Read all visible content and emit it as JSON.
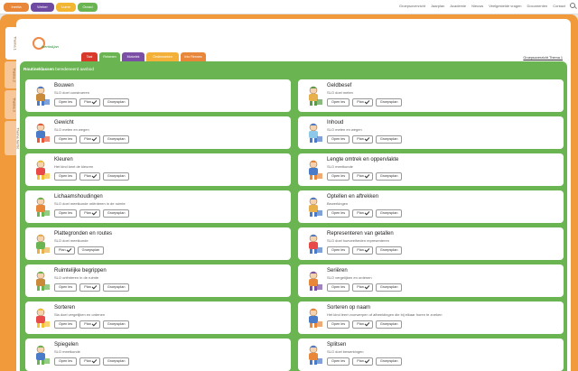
{
  "topbar": {
    "tabs": [
      {
        "label": "Inertia",
        "color": "#e8873a"
      },
      {
        "label": "Weber",
        "color": "#6e4aa0"
      },
      {
        "label": "Lume",
        "color": "#f2b632"
      },
      {
        "label": "Oorad",
        "color": "#6ab552"
      }
    ],
    "links": [
      "Groepsoverzicht",
      "Jaarplan",
      "Academie",
      "Nieuws",
      "Veelgestelde vragen",
      "Documenten",
      "Contact"
    ]
  },
  "sidetabs": [
    "Thema 1",
    "Thema 2",
    "Thema 3",
    "Thema herfst"
  ],
  "logo": {
    "text": "inertia&jan"
  },
  "content_tabs": [
    {
      "label": "Taal",
      "color": "#d8392b"
    },
    {
      "label": "Rekenen",
      "color": "#6ab552"
    },
    {
      "label": "Motoriek",
      "color": "#7b4fa5"
    },
    {
      "label": "Onderzoeken",
      "color": "#f4b13a"
    },
    {
      "label": "Inlo Rennes",
      "color": "#e8873a"
    }
  ],
  "overview_link": "Groepsoverzicht Thema 1",
  "section": {
    "bold": "Routineklassen",
    "rest": " beredeneerd aanbod"
  },
  "cards": [
    {
      "title": "Bouwen",
      "sub": "SLO doel construeren",
      "buttons": [
        "Open les",
        "Plan",
        "Groepsplan"
      ],
      "thumb": "builder-icon"
    },
    {
      "title": "Geldbesef",
      "sub": "SLO doel meten",
      "buttons": [
        "Open les",
        "Plan",
        "Groepsplan"
      ],
      "thumb": "money-icon"
    },
    {
      "title": "Gewicht",
      "sub": "SLO meten en wegen",
      "buttons": [
        "Open les",
        "Plan",
        "Groepsplan"
      ],
      "thumb": "scale-icon"
    },
    {
      "title": "Inhoud",
      "sub": "SLO meten en wegen",
      "buttons": [
        "Open les",
        "Plan",
        "Groepsplan"
      ],
      "thumb": "glass-icon"
    },
    {
      "title": "Kleuren",
      "sub": "Het kind kent de kleuren",
      "buttons": [
        "Open les",
        "Plan",
        "Groepsplan"
      ],
      "thumb": "colors-icon"
    },
    {
      "title": "Lengte omtrek en oppervlakte",
      "sub": "SLO meetkunde",
      "buttons": [
        "Open les",
        "Plan",
        "Groepsplan"
      ],
      "thumb": "ruler-icon"
    },
    {
      "title": "Lichaamshoudingen",
      "sub": "SLO doel meetkunde oriënteren in de ruimte",
      "buttons": [
        "Open les",
        "Plan",
        "Groepsplan"
      ],
      "thumb": "child-icon"
    },
    {
      "title": "Optellen en aftrekken",
      "sub": "Bewerkingen",
      "buttons": [
        "Open les",
        "Plan",
        "Groepsplan"
      ],
      "thumb": "counting-icon"
    },
    {
      "title": "Plattegronden en routes",
      "sub": "SLO doel meetkunde",
      "buttons": [
        "Plan",
        "Groepsplan"
      ],
      "thumb": "map-icon"
    },
    {
      "title": "Representeren van getallen",
      "sub": "SLO doel hoeveelheden representeren",
      "buttons": [
        "Open les",
        "Plan",
        "Groepsplan"
      ],
      "thumb": "numbers-icon"
    },
    {
      "title": "Ruimtelijke begrippen",
      "sub": "SLO oriënteren in de ruimte",
      "buttons": [
        "Open les",
        "Plan",
        "Groepsplan"
      ],
      "thumb": "box-icon"
    },
    {
      "title": "Seriëren",
      "sub": "SLO vergelijken en ordenen",
      "buttons": [
        "Open les",
        "Plan",
        "Groepsplan"
      ],
      "thumb": "series-icon"
    },
    {
      "title": "Sorteren",
      "sub": "Sla doel vergelijken en ordenen",
      "buttons": [
        "Open les",
        "Plan",
        "Groepsplan"
      ],
      "thumb": "sorting-icon"
    },
    {
      "title": "Sorteren op naam",
      "sub": "Het kind leert voorwerpen of afbeeldingen die bij elkaar horen te zoeken",
      "buttons": [
        "Open les",
        "Plan",
        "Groepsplan"
      ],
      "thumb": "name-sort-icon"
    },
    {
      "title": "Spiegelen",
      "sub": "SLO meetkunde",
      "buttons": [
        "Open les",
        "Plan",
        "Groepsplan"
      ],
      "thumb": "mirror-icon"
    },
    {
      "title": "Splitsen",
      "sub": "SLO doel bewerkingen",
      "buttons": [
        "Open les",
        "Plan",
        "Groepsplan"
      ],
      "thumb": "split-icon"
    }
  ]
}
